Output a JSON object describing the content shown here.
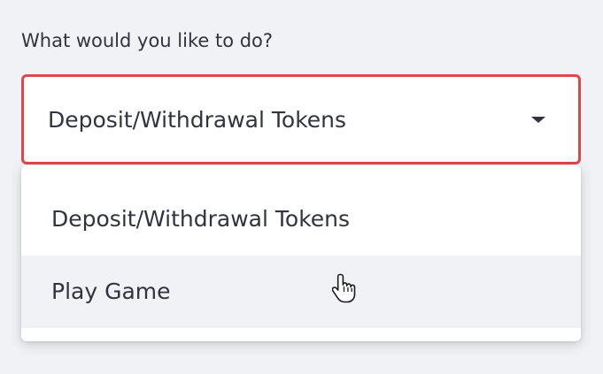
{
  "question": {
    "label": "What would you like to do?"
  },
  "select": {
    "selected_value": "Deposit/Withdrawal Tokens",
    "caret_icon": "caret-down-icon",
    "border_color": "#e0464b"
  },
  "dropdown": {
    "options": [
      {
        "label": "Deposit/Withdrawal Tokens",
        "hovered": false
      },
      {
        "label": "Play Game",
        "hovered": true
      }
    ]
  },
  "cursor": {
    "icon": "hand-pointer-icon"
  },
  "colors": {
    "background": "#f0f2f6",
    "text": "#31333f",
    "hover_background": "#f0f2f6"
  }
}
